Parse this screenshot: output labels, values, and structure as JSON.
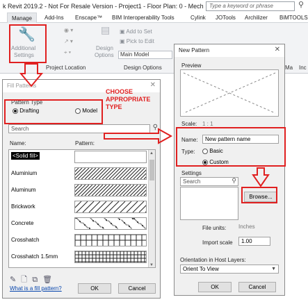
{
  "app": {
    "title": "k Revit 2019.2 - Not For Resale Version - Project1 - Floor Plan: 0 - Mech",
    "search_placeholder": "Type a keyword or phrase"
  },
  "ribbon": {
    "tabs": [
      "Manage",
      "Add-Ins",
      "Enscape™",
      "BIM Interoperability Tools",
      "Cylink",
      "JOTools",
      "Archilizer",
      "BiMTOOLS"
    ],
    "active_tab": "Manage",
    "additional_settings": [
      "Additional",
      "Settings"
    ],
    "add_to_set": "Add to Set",
    "pick_to_edit": "Pick to Edit",
    "design_options": [
      "Design",
      "Options"
    ],
    "main_model": "Main Model",
    "groups": [
      "Project Location",
      "Design Options",
      "Ma",
      "Inc"
    ]
  },
  "fill_patterns": {
    "title": "Fill Patterns",
    "pattern_type_label": "Pattern Type",
    "drafting_label": "Drafting",
    "model_label": "Model",
    "selected_type": "Drafting",
    "search_placeholder": "Search",
    "col_name": "Name:",
    "col_pattern": "Pattern:",
    "patterns": [
      {
        "name": "<Solid fill>",
        "pattern": "solid",
        "selected": true
      },
      {
        "name": "Aluminium",
        "pattern": "diag-fine"
      },
      {
        "name": "Aluminum",
        "pattern": "diag-fine"
      },
      {
        "name": "Brickwork",
        "pattern": "diag-coarse"
      },
      {
        "name": "Concrete",
        "pattern": "dots"
      },
      {
        "name": "Crosshatch",
        "pattern": "grid"
      },
      {
        "name": "Crosshatch 1.5mm",
        "pattern": "grid-fine"
      }
    ],
    "help_link": "What is a fill pattern?",
    "ok_label": "OK",
    "cancel_label": "Cancel"
  },
  "new_pattern": {
    "title": "New Pattern",
    "preview_label": "Preview",
    "scale_label": "Scale:",
    "scale_value": "1 : 1",
    "name_label": "Name:",
    "name_value": "New pattern name",
    "type_label": "Type:",
    "basic_label": "Basic",
    "custom_label": "Custom",
    "selected_type": "Custom",
    "settings_label": "Settings",
    "search_placeholder": "Search",
    "browse_label": "Browse...",
    "file_units_label": "File units:",
    "file_units_value": "Inches",
    "import_scale_label": "Import scale",
    "import_scale_value": "1.00",
    "orientation_label": "Orientation in Host Layers:",
    "orientation_value": "Orient To View",
    "ok_label": "OK",
    "cancel_label": "Cancel"
  },
  "annotations": {
    "choose_type": [
      "CHOOSE",
      "APPROPRIATE",
      "TYPE"
    ],
    "color": "#e02020"
  }
}
